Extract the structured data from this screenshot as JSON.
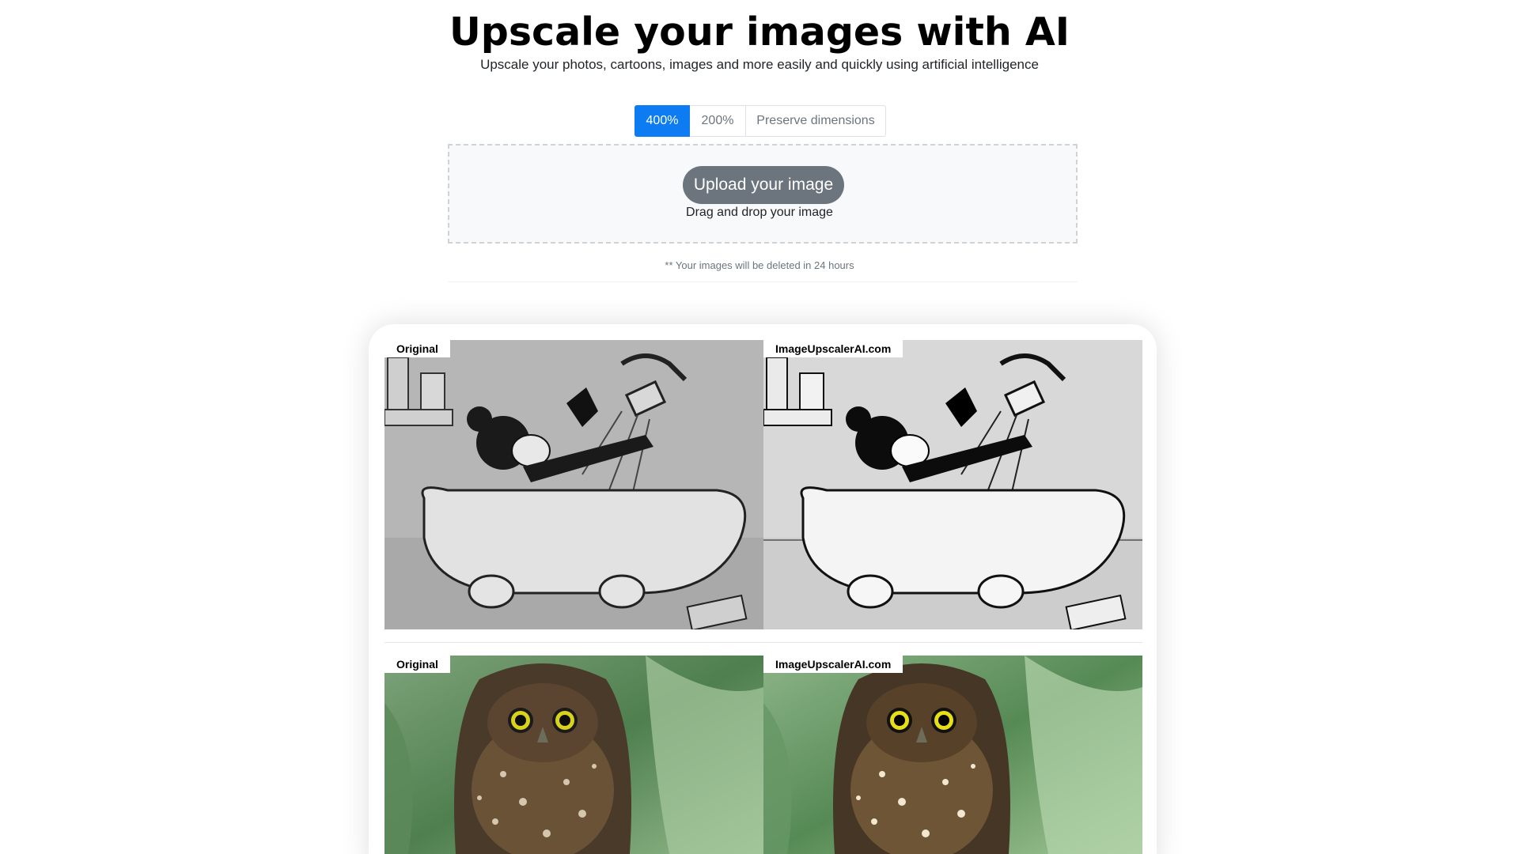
{
  "hero": {
    "title": "Upscale your images with AI",
    "subtitle": "Upscale your photos, cartoons, images and more easily and quickly using artificial intelligence"
  },
  "scale_options": {
    "items": [
      "400%",
      "200%",
      "Preserve dimensions"
    ],
    "selected": "400%"
  },
  "upload": {
    "button_label": "Upload your image",
    "drag_text": "Drag and drop your image",
    "note": "** Your images will be deleted in 24 hours"
  },
  "examples": {
    "label_original": "Original",
    "label_upscaled": "ImageUpscalerAI.com",
    "rows": [
      "cartoon-bathtub",
      "owl-photo"
    ]
  },
  "colors": {
    "accent": "#0d7cf2",
    "upload_button": "#6c757d",
    "dropzone_bg": "#f8f9fa"
  }
}
